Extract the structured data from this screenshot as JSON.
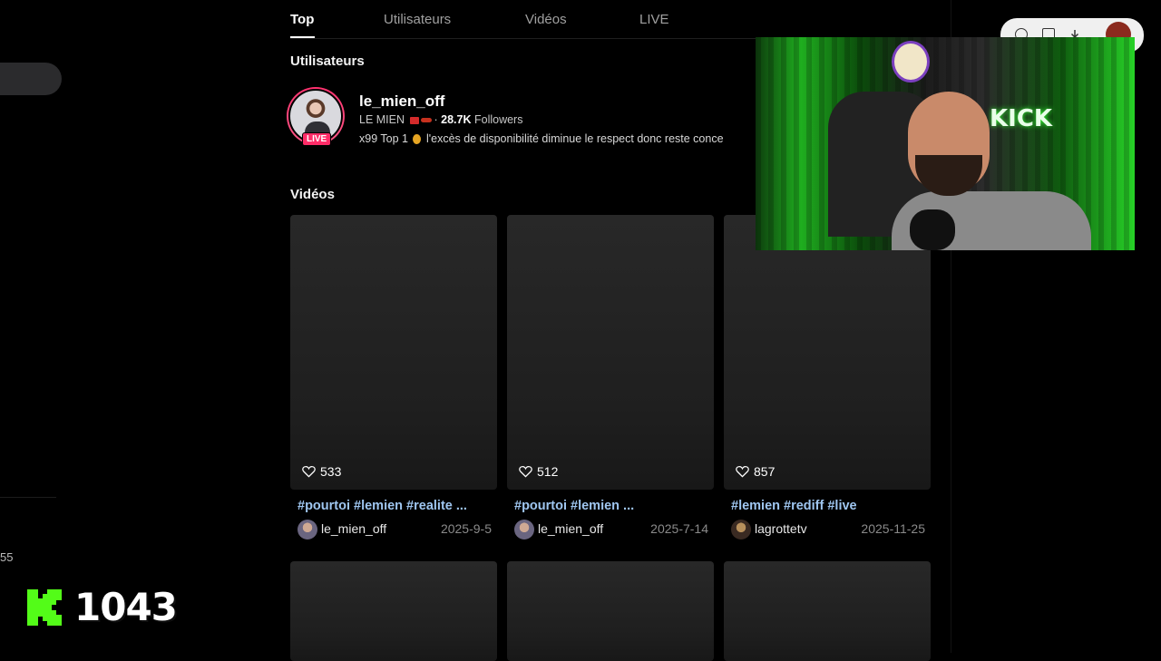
{
  "tabs": [
    {
      "label": "Top"
    },
    {
      "label": "Utilisateurs"
    },
    {
      "label": "Vidéos"
    },
    {
      "label": "LIVE"
    }
  ],
  "sections": {
    "users_title": "Utilisateurs",
    "videos_title": "Vidéos"
  },
  "user": {
    "name": "le_mien_off",
    "display_name": "LE MIEN",
    "followers_count": "28.7K",
    "followers_label": "Followers",
    "bio_prefix": "x99 Top 1",
    "bio_rest": "l'excès de disponibilité diminue le respect donc reste conce",
    "live_label": "LIVE",
    "live_badge_color": "#ff2c68"
  },
  "videos": [
    {
      "likes": "533",
      "caption": "#pourtoi #lemien #realite ...",
      "author": "le_mien_off",
      "date": "2025-9-5"
    },
    {
      "likes": "512",
      "caption": "#pourtoi #lemien ...",
      "author": "le_mien_off",
      "date": "2025-7-14"
    },
    {
      "likes": "857",
      "caption": "#lemien #rediff #live",
      "author": "lagrottetv",
      "date": "2025-11-25"
    }
  ],
  "overlay": {
    "left_number": "55",
    "kick_count": "1043",
    "kick_color": "#53fc18",
    "webcam_sign": "KICK"
  },
  "colors": {
    "hashtag": "#9fc6f0",
    "background": "#000000"
  }
}
